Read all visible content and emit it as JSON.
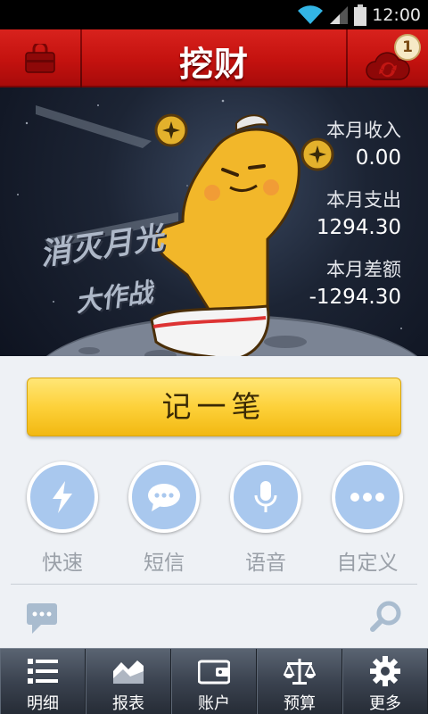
{
  "status_bar": {
    "time": "12:00"
  },
  "header": {
    "title": "挖财",
    "sync_badge": "1",
    "left_icon": "bag-icon",
    "right_icon": "cloud-sync-icon"
  },
  "banner": {
    "slogan_line1": "消灭月光",
    "slogan_line2": "大作战",
    "income_label": "本月收入",
    "income_value": "0.00",
    "expense_label": "本月支出",
    "expense_value": "1294.30",
    "balance_label": "本月差额",
    "balance_value": "-1294.30"
  },
  "main": {
    "record_button": "记一笔",
    "quick_actions": [
      {
        "label": "快速",
        "icon": "lightning-icon"
      },
      {
        "label": "短信",
        "icon": "sms-icon"
      },
      {
        "label": "语音",
        "icon": "microphone-icon"
      },
      {
        "label": "自定义",
        "icon": "more-dots-icon"
      }
    ]
  },
  "tabs": [
    {
      "label": "明细",
      "icon": "list-icon"
    },
    {
      "label": "报表",
      "icon": "chart-icon"
    },
    {
      "label": "账户",
      "icon": "wallet-icon"
    },
    {
      "label": "预算",
      "icon": "scale-icon"
    },
    {
      "label": "更多",
      "icon": "gear-icon"
    }
  ],
  "colors": {
    "header_red": "#c4120f",
    "record_yellow": "#fdd13a",
    "quick_blue": "#a9c8ee",
    "tabbar_dark": "#3b4350"
  }
}
